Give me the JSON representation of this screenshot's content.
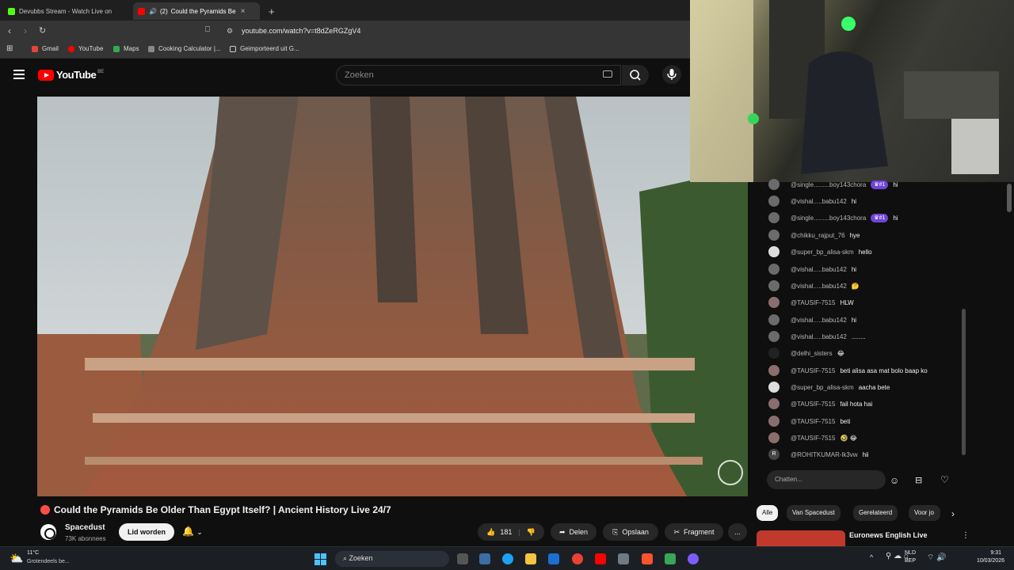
{
  "browser": {
    "tabs": [
      {
        "label": "Devubbs Stream - Watch Live on",
        "active": false
      },
      {
        "label": "(2)",
        "active": true,
        "title": "Could the Pyramids Be"
      }
    ],
    "url": "youtube.com/watch?v=t8dZeRGZgV4",
    "bookmarks": [
      "Gmail",
      "YouTube",
      "Maps",
      "Cooking Calculator |...",
      "Geimporteerd uit G..."
    ]
  },
  "header": {
    "logo_text": "YouTube",
    "logo_region": "BE",
    "search_placeholder": "Zoeken"
  },
  "video": {
    "title": "Could the Pyramids Be Older Than Egypt Itself? | Ancient History Live 24/7",
    "channel": "Spacedust",
    "subscribers": "73K abonnees",
    "join_label": "Lid worden",
    "likes": "181",
    "share_label": "Delen",
    "save_label": "Opslaan",
    "clip_label": "Fragment",
    "more_label": "..."
  },
  "chat": {
    "messages": [
      {
        "author": "@single.........boy143chora",
        "badge": "#1",
        "text": "hi"
      },
      {
        "author": "@vishal.....babu142",
        "badge": "",
        "text": "hi"
      },
      {
        "author": "@single.........boy143chora",
        "badge": "#1",
        "text": "hi"
      },
      {
        "author": "@chikku_rajput_76",
        "badge": "",
        "text": "hye"
      },
      {
        "author": "@super_bp_alisa-skm",
        "badge": "",
        "text": "hello"
      },
      {
        "author": "@vishal.....babu142",
        "badge": "",
        "text": "hi"
      },
      {
        "author": "@vishal.....babu142",
        "badge": "",
        "text": "🤔"
      },
      {
        "author": "@TAUSIF-7515",
        "badge": "",
        "text": "HLW"
      },
      {
        "author": "@vishal.....babu142",
        "badge": "",
        "text": "hi"
      },
      {
        "author": "@vishal.....babu142",
        "badge": "",
        "text": "........"
      },
      {
        "author": "@delhi_sisters",
        "badge": "",
        "text": "😂"
      },
      {
        "author": "@TAUSIF-7515",
        "badge": "",
        "text": "beti alisa asa mat bolo baap ko"
      },
      {
        "author": "@super_bp_alisa-skm",
        "badge": "",
        "text": "aacha bete"
      },
      {
        "author": "@TAUSIF-7515",
        "badge": "",
        "text": "fail hota hai"
      },
      {
        "author": "@TAUSIF-7515",
        "badge": "",
        "text": "beti"
      },
      {
        "author": "@TAUSIF-7515",
        "badge": "",
        "text": "🤣 😂"
      },
      {
        "author": "@ROHITKUMAR-lk3vw",
        "badge": "",
        "text": "hii",
        "avatar_letter": "R"
      }
    ],
    "input_placeholder": "Chatten..."
  },
  "chips": [
    "Alle",
    "Van Spacedust",
    "Gerelateerd",
    "Voor jo"
  ],
  "related": {
    "title": "Euronews English Live"
  },
  "taskbar": {
    "weather_temp": "11°C",
    "weather_desc": "Grotendeels be...",
    "search_label": "Zoeken",
    "lang_top": "NLD",
    "lang_bottom": "BEP",
    "time": "9:31",
    "date": "10/03/2026"
  }
}
